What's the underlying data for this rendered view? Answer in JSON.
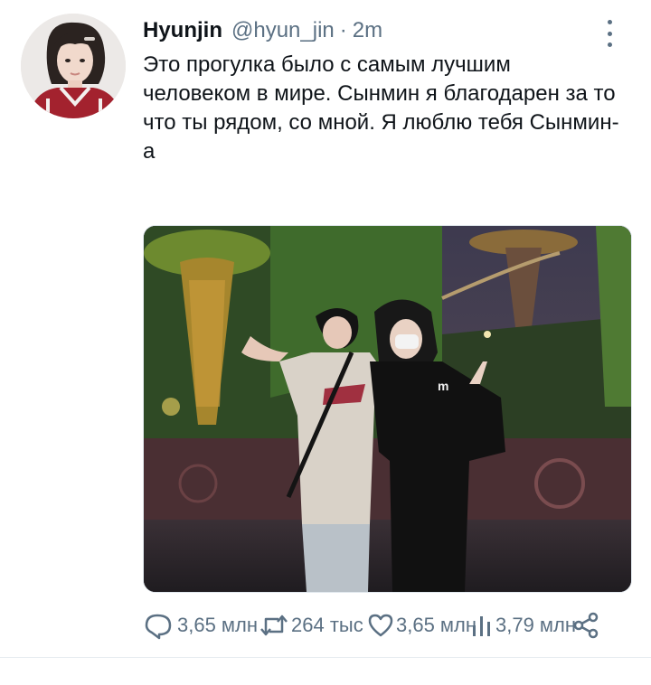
{
  "tweet": {
    "display_name": "Hyunjin",
    "handle": "@hyun_jin",
    "separator": "·",
    "time": "2m",
    "text": "Это прогулка было с самым лучшим человеком в мире. Сынмин я благодарен за то что ты рядом, со мной. Я люблю тебя Сынмин-а",
    "actions": {
      "reply_count": "3,65 млн",
      "retweet_count": "264 тыс",
      "like_count": "3,65 млн",
      "views_count": "3,79 млн"
    }
  },
  "icons": {
    "more": "more-vertical-icon",
    "reply": "reply-icon",
    "retweet": "retweet-icon",
    "like": "heart-icon",
    "views": "analytics-icon",
    "share": "share-icon"
  },
  "colors": {
    "text_primary": "#0f1419",
    "text_secondary": "#5b7083",
    "divider": "#e6ecf0"
  }
}
